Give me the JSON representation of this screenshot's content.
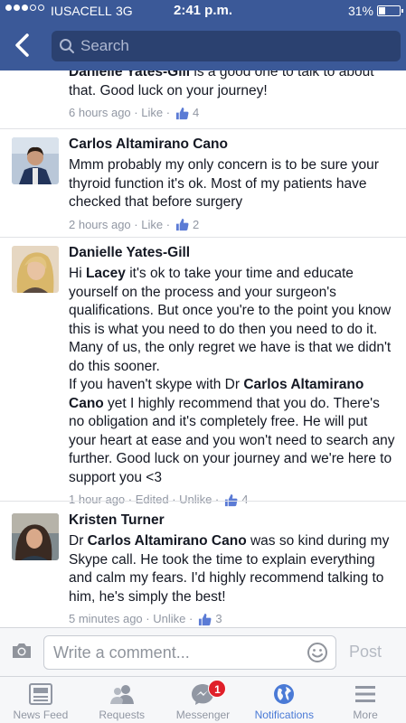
{
  "status_bar": {
    "carrier": "IUSACELL",
    "network": "3G",
    "time": "2:41 p.m.",
    "battery": "31%",
    "battery_level": 0.31,
    "signal_bars_filled": 3,
    "signal_bars_total": 5
  },
  "nav": {
    "search_placeholder": "Search",
    "accent": "#3b5998"
  },
  "comments": [
    {
      "author": "",
      "text_parts": [
        {
          "bold": true,
          "text": "Danielle Yates-Gill"
        },
        {
          "bold": false,
          "text": " is a good one to talk to about that.  Good luck on your journey!"
        }
      ],
      "time": "6 hours ago",
      "actions": [
        "Like"
      ],
      "likes": "4"
    },
    {
      "author": "Carlos Altamirano Cano",
      "text_parts": [
        {
          "bold": false,
          "text": "Mmm probably my only concern is to be sure your thyroid function it's ok. Most of my patients have checked that before surgery"
        }
      ],
      "time": "2 hours ago",
      "actions": [
        "Like"
      ],
      "likes": "2"
    },
    {
      "author": "Danielle Yates-Gill",
      "text_parts": [
        {
          "bold": false,
          "text": "Hi "
        },
        {
          "bold": true,
          "text": "Lacey"
        },
        {
          "bold": false,
          "text": " it's ok to take your time and educate yourself on the process and your surgeon's qualifications.  But once you're to the point you know this is what you need to do then you need to do it.  Many of us, the only regret we have is that we didn't do this sooner.\nIf you haven't skype with Dr "
        },
        {
          "bold": true,
          "text": "Carlos Altamirano Cano"
        },
        {
          "bold": false,
          "text": " yet I highly recommend that you do.  There's no obligation and it's completely free.  He will put your heart at ease and you won't need to search any further.  Good luck on your journey and we're here to support you <3"
        }
      ],
      "time": "1 hour ago",
      "actions": [
        "Edited",
        "Unlike"
      ],
      "likes": "4"
    },
    {
      "author": "Kristen Turner",
      "text_parts": [
        {
          "bold": false,
          "text": "Dr "
        },
        {
          "bold": true,
          "text": "Carlos Altamirano Cano"
        },
        {
          "bold": false,
          "text": " was so kind during my Skype call.  He took the time to explain everything and calm my fears.  I'd highly recommend talking to him, he's simply the best!"
        }
      ],
      "time": "5 minutes ago",
      "actions": [
        "Unlike"
      ],
      "likes": "3"
    }
  ],
  "composer": {
    "placeholder": "Write a comment...",
    "post_label": "Post"
  },
  "tabs": [
    {
      "label": "News Feed",
      "icon": "news-feed-icon",
      "active": false,
      "badge": ""
    },
    {
      "label": "Requests",
      "icon": "friend-requests-icon",
      "active": false,
      "badge": ""
    },
    {
      "label": "Messenger",
      "icon": "messenger-icon",
      "active": false,
      "badge": "1"
    },
    {
      "label": "Notifications",
      "icon": "globe-icon",
      "active": true,
      "badge": ""
    },
    {
      "label": "More",
      "icon": "menu-icon",
      "active": false,
      "badge": ""
    }
  ],
  "colors": {
    "link_blue": "#3b5998",
    "active_tab": "#4a7ad6",
    "meta_gray": "#9197a3",
    "badge_red": "#e0202a"
  }
}
